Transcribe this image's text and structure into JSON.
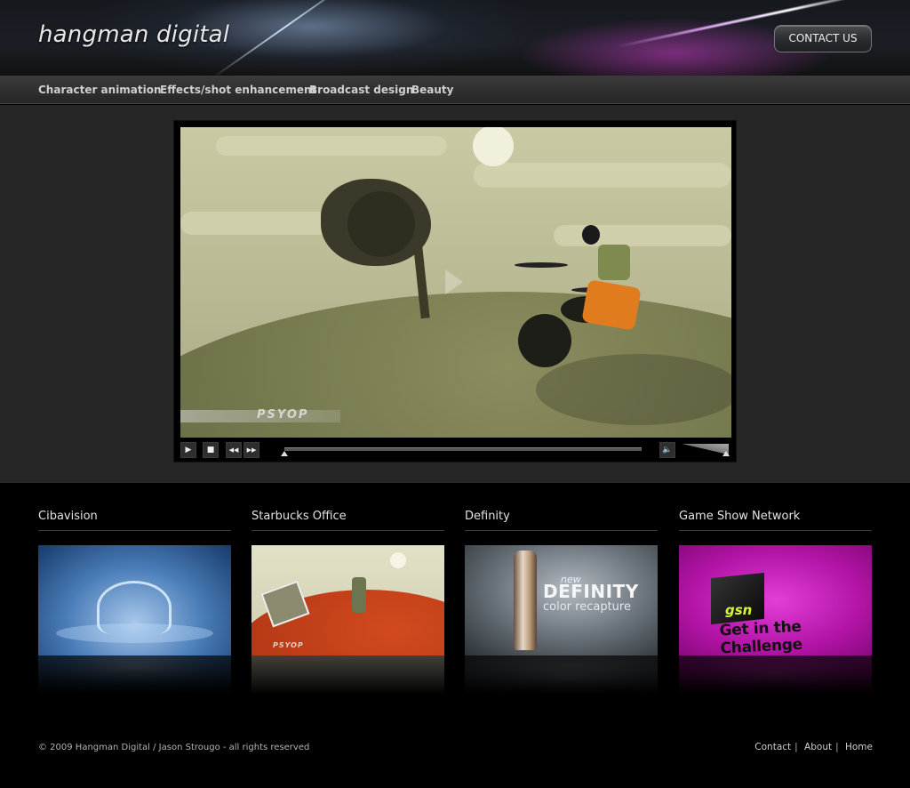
{
  "header": {
    "logo": "hangman digital",
    "contact_button": "CONTACT US"
  },
  "nav": {
    "items": [
      {
        "label": "Character animation"
      },
      {
        "label": "Effects/shot enhancement"
      },
      {
        "label": "Broadcast design"
      },
      {
        "label": "Beauty"
      }
    ]
  },
  "player": {
    "watermark": "PSYOP",
    "controls": {
      "play": "▶",
      "stop": "■",
      "rewind": "◀◀",
      "forward": "▶▶",
      "volume": "🔈"
    },
    "progress": 0.0,
    "volume_level": 1.0
  },
  "portfolio": {
    "items": [
      {
        "title": "Cibavision",
        "icon": "water-splash-thumbnail"
      },
      {
        "title": "Starbucks Office",
        "icon": "animated-house-thumbnail",
        "watermark": "PSYOP"
      },
      {
        "title": "Definity",
        "icon": "definity-bottle-thumbnail",
        "lines": [
          "new",
          "DEFINITY",
          "color recapture"
        ]
      },
      {
        "title": "Game Show Network",
        "icon": "gsn-cube-thumbnail",
        "lines": [
          "gsn",
          "Get in the Challenge"
        ]
      }
    ]
  },
  "footer": {
    "copyright": "© 2009 Hangman Digital / Jason Strougo - all rights reserved",
    "links": [
      "Contact",
      "About",
      "Home"
    ]
  }
}
